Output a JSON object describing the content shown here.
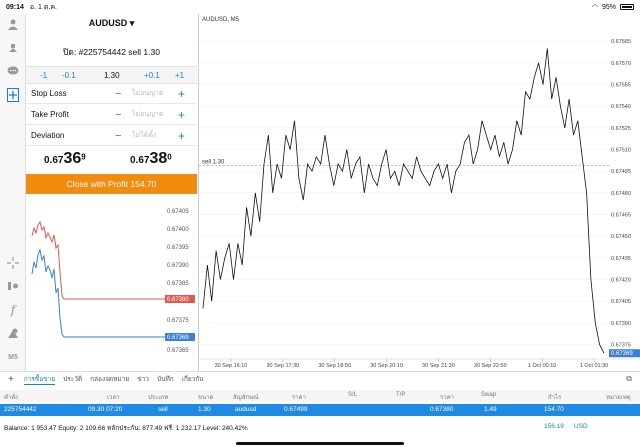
{
  "status": {
    "time": "09:14",
    "date": "อ. 1 ต.ค.",
    "battery": "95%"
  },
  "sidebar": {
    "icons": [
      "user-icon",
      "deposit-icon",
      "chat-icon",
      "new-order-icon",
      "crosshair-icon",
      "indicators-icon",
      "function-icon",
      "objects-icon"
    ],
    "timeframe": "M5"
  },
  "order": {
    "symbol": "AUDUSD ▾",
    "position": "ปิด: #225754442 sell 1.30",
    "steps": {
      "m1": "-1",
      "m01": "-0.1",
      "volume": "1.30",
      "p01": "+0.1",
      "p1": "+1"
    },
    "stop_loss": {
      "label": "Stop Loss",
      "placeholder": "ไม่อนุญาต"
    },
    "take_profit": {
      "label": "Take Profit",
      "placeholder": "ไม่อนุญาต"
    },
    "deviation": {
      "label": "Deviation",
      "placeholder": "ไม่ได้ตั้ง"
    },
    "bid": {
      "small": "0.67",
      "big": "36",
      "sup": "9"
    },
    "ask": {
      "small": "0.67",
      "big": "38",
      "sup": "0"
    },
    "close_button": "Close with Profit 154.70"
  },
  "mini_chart": {
    "labels": [
      "0.67405",
      "0.67400",
      "0.67395",
      "0.67390",
      "0.67385",
      "0.67380",
      "0.67375",
      "0.67369",
      "0.67365"
    ],
    "ask_badge": "0.67380",
    "bid_badge": "0.67369",
    "colors": {
      "ask": "#e05a4f",
      "bid": "#3b7fd6"
    }
  },
  "chart_data": {
    "type": "line",
    "title": "AUDUSD, M5",
    "ylim": [
      0.67365,
      0.6759
    ],
    "y_ticks": [
      "0.67585",
      "0.67570",
      "0.67555",
      "0.67540",
      "0.67525",
      "0.67510",
      "0.67495",
      "0.67480",
      "0.67465",
      "0.67450",
      "0.67435",
      "0.67420",
      "0.67405",
      "0.67390",
      "0.67375"
    ],
    "x_ticks": [
      "30 Sep 16:10",
      "30 Sep 17:30",
      "30 Sep 18:50",
      "30 Sep 20:10",
      "30 Sep 21:30",
      "30 Sep 22:50",
      "1 Oct 00:10",
      "1 Oct 01:30"
    ],
    "sell_line": {
      "label": "sell 1.30",
      "price": 0.67499
    },
    "current_price": "0.67369",
    "series": [
      {
        "values": [
          0.674,
          0.6743,
          0.67405,
          0.6744,
          0.6742,
          0.67435,
          0.67445,
          0.6742,
          0.67445,
          0.6743,
          0.6747,
          0.6745,
          0.6748,
          0.6746,
          0.675,
          0.6752,
          0.6748,
          0.675,
          0.6749,
          0.6752,
          0.6751,
          0.6753,
          0.6749,
          0.67475,
          0.675,
          0.67495,
          0.67505,
          0.675,
          0.6752,
          0.675,
          0.67485,
          0.675,
          0.67495,
          0.6751,
          0.6749,
          0.675,
          0.67505,
          0.6748,
          0.675,
          0.6749,
          0.67485,
          0.675,
          0.6751,
          0.6749,
          0.67495,
          0.67485,
          0.675,
          0.67495,
          0.6749,
          0.67505,
          0.67495,
          0.6749,
          0.67485,
          0.67495,
          0.675,
          0.6749,
          0.675,
          0.6748,
          0.67495,
          0.675,
          0.67515,
          0.6752,
          0.675,
          0.6751,
          0.6753,
          0.6752,
          0.6751,
          0.6752,
          0.67505,
          0.67515,
          0.675,
          0.6751,
          0.6753,
          0.6752,
          0.6755,
          0.67545,
          0.6756,
          0.6757,
          0.67555,
          0.6758,
          0.67545,
          0.6756,
          0.6754,
          0.67525,
          0.67545,
          0.6752,
          0.6753,
          0.67505,
          0.6748,
          0.6742,
          0.6739,
          0.67375,
          0.67369
        ]
      }
    ]
  },
  "terminal": {
    "tabs": [
      "การซื้อขาย",
      "ประวัติ",
      "กล่องจดหมาย",
      "ข่าว",
      "บันทึก",
      "เกี่ยวกับ"
    ],
    "columns": [
      "คำสั่ง",
      "เวลา",
      "ประเภท",
      "ขนาด",
      "สัญลักษณ์",
      "ราคา",
      "S/L",
      "T/P",
      "ราคา",
      "Swap",
      "กำไร",
      "หมายเหตุ"
    ],
    "row": {
      "order": "225754442",
      "time": "09.30 07:20",
      "type": "sell",
      "size": "1.30",
      "symbol": "audusd",
      "price": "0.67499",
      "current": "0.67380",
      "swap": "1.49",
      "profit": "154.70"
    },
    "balance": "Balance: 1 953.47 Equity: 2 109.66 หลักประกัน: 877.49 ฟรี: 1 232.17 Level: 240.42%",
    "total": "156.19",
    "currency": "USD"
  }
}
